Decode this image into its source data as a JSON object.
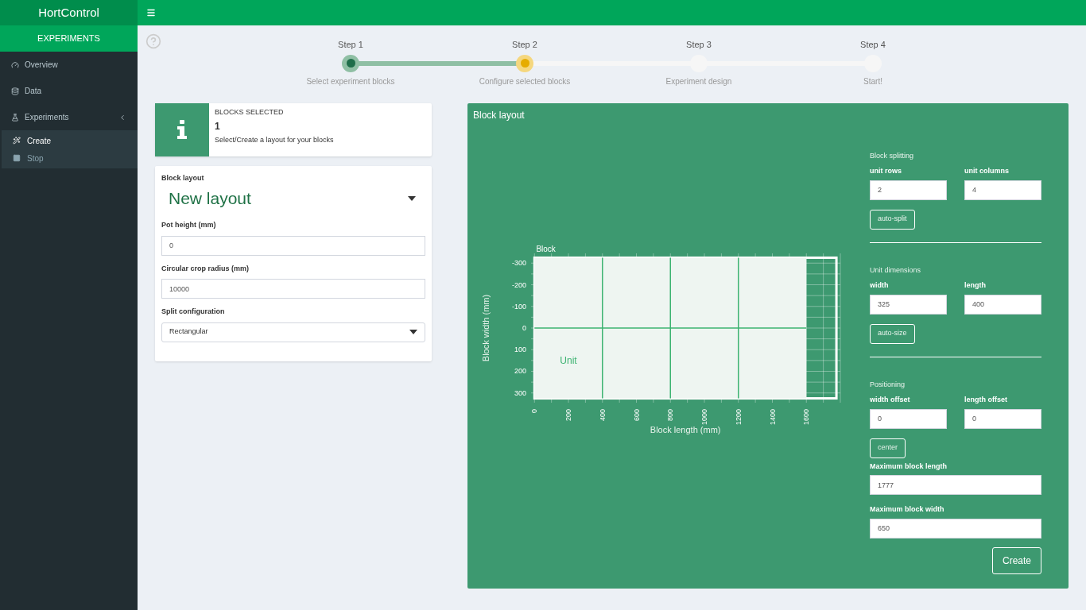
{
  "brand": "HortControl",
  "sidebar": {
    "section": "EXPERIMENTS",
    "items": [
      {
        "label": "Overview"
      },
      {
        "label": "Data"
      },
      {
        "label": "Experiments",
        "expanded": true,
        "children": [
          {
            "label": "Create",
            "selected": true
          },
          {
            "label": "Stop",
            "selected": false
          }
        ]
      }
    ]
  },
  "steps": [
    {
      "title": "Step 1",
      "caption": "Select experiment blocks",
      "completed": true,
      "selected": false
    },
    {
      "title": "Step 2",
      "caption": "Configure selected blocks",
      "completed": false,
      "selected": true
    },
    {
      "title": "Step 3",
      "caption": "Experiment design",
      "completed": false,
      "selected": false
    },
    {
      "title": "Step 4",
      "caption": "Start!",
      "completed": false,
      "selected": false
    }
  ],
  "info_box": {
    "title": "BLOCKS SELECTED",
    "count": "1",
    "text": "Select/Create a layout for your blocks"
  },
  "settings": {
    "layout_label": "Block layout",
    "layout_value": "New layout",
    "fields": [
      {
        "label": "Pot height (mm)",
        "value": "0"
      },
      {
        "label": "Circular crop radius (mm)",
        "value": "10000"
      }
    ],
    "split_label": "Split configuration",
    "split_value": "Rectangular"
  },
  "panel": {
    "title": "Block layout",
    "chart_data": {
      "type": "line",
      "xlabel": "Block length (mm)",
      "ylabel": "Block width (mm)",
      "xlim": [
        -20,
        1800
      ],
      "ylim": [
        345,
        -345
      ],
      "xticks": [
        0,
        200,
        400,
        600,
        800,
        1000,
        1200,
        1400,
        1600
      ],
      "yticks": [
        {
          "value": -300,
          "label": "-300"
        },
        {
          "value": -200,
          "label": "-200"
        },
        {
          "value": -100,
          "label": "-100"
        },
        0,
        100,
        200,
        300
      ],
      "annotations": [
        "Block",
        "Unit"
      ],
      "grid": true,
      "bands": [
        {
          "axis": "x",
          "from": 0,
          "to": 1600
        }
      ]
    },
    "sections": [
      {
        "title": "Block splitting",
        "fields": [
          {
            "label": "unit rows",
            "value": "2"
          },
          {
            "label": "unit columns",
            "value": "4"
          }
        ],
        "button": "auto-split"
      },
      {
        "title": "Unit dimensions",
        "fields": [
          {
            "label": "width",
            "value": "325"
          },
          {
            "label": "length",
            "value": "400"
          }
        ],
        "button": "auto-size"
      },
      {
        "title": "Positioning",
        "fields": [
          {
            "label": "width offset",
            "value": "0"
          },
          {
            "label": "length offset",
            "value": "0"
          }
        ],
        "button": "center",
        "full_fields": [
          {
            "label": "Maximum block length",
            "value": "1777"
          },
          {
            "label": "Maximum block width",
            "value": "650"
          }
        ]
      }
    ],
    "submit": "Create"
  }
}
